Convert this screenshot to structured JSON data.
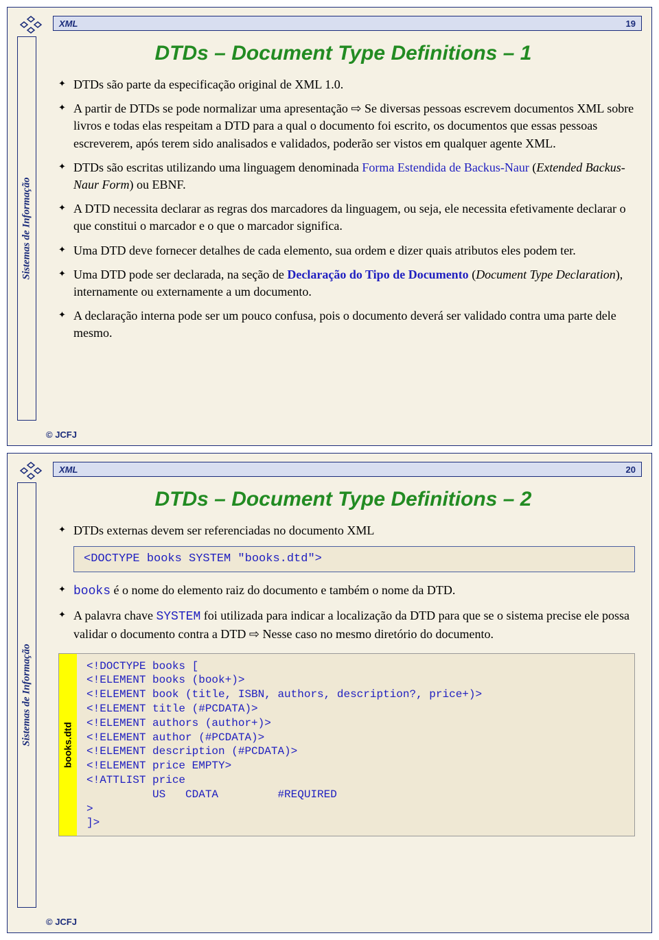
{
  "slides": [
    {
      "header": "XML",
      "page": "19",
      "sidebar": "Sistemas de Informação",
      "title": "DTDs – Document Type Definitions – 1",
      "bullets": [
        {
          "type": "plain",
          "text": "DTDs são parte da especificação original de XML 1.0."
        },
        {
          "type": "arrow",
          "pre": "A partir de DTDs se pode normalizar uma apresentação ",
          "post": " Se diversas pessoas escrevem documentos XML sobre livros e todas elas respeitam a DTD para a qual o documento foi escrito, os documentos que essas pessoas escreverem, após terem sido analisados e validados, poderão ser vistos em qualquer agente XML."
        },
        {
          "type": "ebnf",
          "pre": "DTDs são escritas utilizando uma linguagem denominada ",
          "link": "Forma Estendida de Backus-Naur",
          "mid": " (",
          "italic": "Extended Backus-Naur Form",
          "post": ") ou EBNF."
        },
        {
          "type": "plain",
          "text": "A DTD necessita declarar as regras dos marcadores da linguagem, ou seja, ele necessita efetivamente declarar o que constitui o marcador e o que o marcador significa."
        },
        {
          "type": "plain",
          "text": "Uma DTD deve fornecer detalhes de cada elemento, sua ordem e dizer quais atributos eles podem ter."
        },
        {
          "type": "decl",
          "pre": "Uma DTD pode ser declarada, na seção de ",
          "bold": "Declaração do Tipo de Documento",
          "mid": " (",
          "italic": "Document Type Declaration",
          "post": "), internamente ou externamente a um documento."
        },
        {
          "type": "plain",
          "text": "A declaração interna pode ser um pouco confusa, pois o documento deverá ser validado contra uma parte dele mesmo."
        }
      ],
      "footer": "© JCFJ"
    },
    {
      "header": "XML",
      "page": "20",
      "sidebar": "Sistemas de Informação",
      "title": "DTDs – Document Type Definitions – 2",
      "b1": "DTDs externas devem ser referenciadas no documento XML",
      "code1": "<DOCTYPE books SYSTEM \"books.dtd\">",
      "b2_code": "books",
      "b2_rest": " é o nome do elemento raiz do documento e também o nome da DTD.",
      "b3_pre": "A palavra chave ",
      "b3_code": "SYSTEM",
      "b3_mid": " foi utilizada para indicar a localização da DTD para que se o sistema precise ele possa validar o documento contra a DTD ",
      "b3_post": " Nesse caso no mesmo diretório do documento.",
      "code2_label": "books.dtd",
      "code2": "<!DOCTYPE books [\n<!ELEMENT books (book+)>\n<!ELEMENT book (title, ISBN, authors, description?, price+)>\n<!ELEMENT title (#PCDATA)>\n<!ELEMENT authors (author+)>\n<!ELEMENT author (#PCDATA)>\n<!ELEMENT description (#PCDATA)>\n<!ELEMENT price EMPTY>\n<!ATTLIST price\n          US   CDATA         #REQUIRED\n>\n]>",
      "footer": "© JCFJ"
    }
  ],
  "arrow_glyph": "⇨"
}
